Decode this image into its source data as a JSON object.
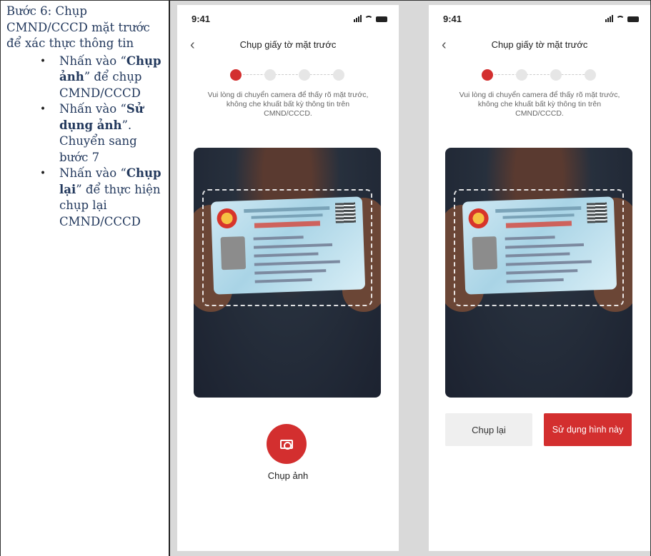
{
  "instructions": {
    "title": "Bước 6: Chụp CMND/CCCD mặt trước để xác thực thông tin",
    "items": [
      {
        "pre": "Nhấn vào “",
        "bold": "Chụp ảnh",
        "post": "” để chụp CMND/CCCD"
      },
      {
        "pre": "Nhấn vào “",
        "bold": "Sử dụng ảnh",
        "post": "”. Chuyển sang bước 7"
      },
      {
        "pre": "Nhấn vào “",
        "bold": "Chụp lại",
        "post": "” để thực hiện chụp lại CMND/CCCD"
      }
    ],
    "bullet": "•"
  },
  "screen_capture": {
    "status_time": "9:41",
    "back_icon": "chevron-left-icon",
    "title": "Chụp giấy tờ mặt trước",
    "hint": "Vui lòng di chuyển camera để thấy rõ mặt trước, không che khuất bất kỳ thông tin trên CMND/CCCD.",
    "capture_label": "Chụp ảnh",
    "capture_icon": "camera-icon",
    "steps_total": 4,
    "step_active": 1
  },
  "screen_review": {
    "status_time": "9:41",
    "back_icon": "chevron-left-icon",
    "title": "Chụp giấy tờ mặt trước",
    "hint": "Vui lòng di chuyển camera để thấy rõ mặt trước, không che khuất bất kỳ thông tin trên CMND/CCCD.",
    "retake_label": "Chụp lại",
    "use_label": "Sử dụng hình này",
    "steps_total": 4,
    "step_active": 1
  },
  "colors": {
    "accent": "#d32f2f",
    "instruction_text": "#23395d"
  }
}
